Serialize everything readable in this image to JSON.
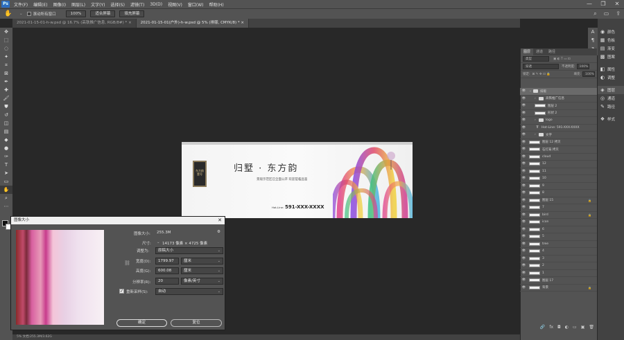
{
  "menu": {
    "logo": "Ps",
    "items": [
      "文件(F)",
      "编辑(E)",
      "图像(I)",
      "图层(L)",
      "文字(Y)",
      "选择(S)",
      "滤镜(T)",
      "3D(D)",
      "视图(V)",
      "窗口(W)",
      "帮助(H)"
    ]
  },
  "window_controls": [
    "—",
    "❐",
    "✕"
  ],
  "options": {
    "scroll_all": "滚动所有窗口",
    "zoom": "100%",
    "fit_screen": "适合屏幕",
    "fill_screen": "填充屏幕"
  },
  "tabs": [
    {
      "label": "2021-01-15-01-h-w.psd @ 16.7% (高铁推广信息, RGB/8#) *",
      "close": "×"
    },
    {
      "label": "2021-01-15-01(户外)-h-w.psd @ 5% (排版, CMYK/8) *",
      "close": "×"
    }
  ],
  "banner": {
    "logo_text": "东方韵 壹号",
    "title": "归墅 · 东方韵",
    "subtitle": "景观示范区已全面公开  欢迎莅临品鉴",
    "hotline_label": "Hot-Line:",
    "phone": "591-XXX-XXXX"
  },
  "right_dock": [
    {
      "icon": "color-icon",
      "glyph": "◉",
      "label": "颜色"
    },
    {
      "icon": "swatches-icon",
      "glyph": "▦",
      "label": "色板"
    },
    {
      "icon": "gradient-icon",
      "glyph": "▤",
      "label": "渐变"
    },
    {
      "icon": "pattern-icon",
      "glyph": "▩",
      "label": "图案"
    },
    {
      "icon": "properties-icon",
      "glyph": "◧",
      "label": "属性"
    },
    {
      "icon": "adjustments-icon",
      "glyph": "◐",
      "label": "调整"
    },
    {
      "icon": "layers-icon",
      "glyph": "◈",
      "label": "图层"
    },
    {
      "icon": "channels-icon",
      "glyph": "◎",
      "label": "通道"
    },
    {
      "icon": "paths-icon",
      "glyph": "✎",
      "label": "路径"
    },
    {
      "icon": "styles-icon",
      "glyph": "❖",
      "label": "样式"
    }
  ],
  "layers_panel": {
    "tabs": [
      "图层",
      "通道",
      "路径"
    ],
    "filter": "类型",
    "blend": "穿透",
    "opacity_label": "不透明度:",
    "opacity": "100%",
    "lock_label": "锁定:",
    "fill_label": "填充:",
    "fill": "100%",
    "layers": [
      {
        "name": "排版",
        "kind": "group",
        "indent": 0,
        "selected": true,
        "lock": false
      },
      {
        "name": "高铁推广信息",
        "kind": "group",
        "indent": 1,
        "selected": false,
        "lock": false
      },
      {
        "name": "图层 2",
        "kind": "pixel",
        "indent": 1,
        "selected": false,
        "lock": false
      },
      {
        "name": "形状 2",
        "kind": "pixel",
        "indent": 1,
        "selected": false,
        "lock": false
      },
      {
        "name": "logo",
        "kind": "group",
        "indent": 1,
        "selected": false,
        "lock": false
      },
      {
        "name": "Hot-Line: 591-XXX-XXXX",
        "kind": "text",
        "indent": 1,
        "selected": false,
        "lock": false
      },
      {
        "name": "文字",
        "kind": "group",
        "indent": 1,
        "selected": false,
        "lock": false
      },
      {
        "name": "图层 12 拷贝",
        "kind": "pixel",
        "indent": 0,
        "selected": false,
        "lock": false
      },
      {
        "name": "石灯笼 拷贝",
        "kind": "pixel",
        "indent": 0,
        "selected": false,
        "lock": false
      },
      {
        "name": "cloud",
        "kind": "pixel",
        "indent": 0,
        "selected": false,
        "lock": false
      },
      {
        "name": "12",
        "kind": "pixel",
        "indent": 0,
        "selected": false,
        "lock": false
      },
      {
        "name": "11",
        "kind": "pixel",
        "indent": 0,
        "selected": false,
        "lock": false
      },
      {
        "name": "10",
        "kind": "pixel",
        "indent": 0,
        "selected": false,
        "lock": false
      },
      {
        "name": "9",
        "kind": "pixel",
        "indent": 0,
        "selected": false,
        "lock": false
      },
      {
        "name": "8",
        "kind": "pixel",
        "indent": 0,
        "selected": false,
        "lock": false
      },
      {
        "name": "图层 15",
        "kind": "pixel",
        "indent": 0,
        "selected": false,
        "lock": true
      },
      {
        "name": "7",
        "kind": "pixel",
        "indent": 0,
        "selected": false,
        "lock": false
      },
      {
        "name": "bird",
        "kind": "pixel",
        "indent": 0,
        "selected": false,
        "lock": true
      },
      {
        "name": "icon",
        "kind": "pixel",
        "indent": 0,
        "selected": false,
        "lock": false
      },
      {
        "name": "6",
        "kind": "pixel",
        "indent": 0,
        "selected": false,
        "lock": false
      },
      {
        "name": "5",
        "kind": "pixel",
        "indent": 0,
        "selected": false,
        "lock": false
      },
      {
        "name": "tree",
        "kind": "pixel",
        "indent": 0,
        "selected": false,
        "lock": false
      },
      {
        "name": "4",
        "kind": "pixel",
        "indent": 0,
        "selected": false,
        "lock": false
      },
      {
        "name": "3",
        "kind": "pixel",
        "indent": 0,
        "selected": false,
        "lock": false
      },
      {
        "name": "2",
        "kind": "pixel",
        "indent": 0,
        "selected": false,
        "lock": false
      },
      {
        "name": "1",
        "kind": "pixel",
        "indent": 0,
        "selected": false,
        "lock": false
      },
      {
        "name": "图层 17",
        "kind": "pixel",
        "indent": 0,
        "selected": false,
        "lock": false
      },
      {
        "name": "背景",
        "kind": "pixel",
        "indent": 0,
        "selected": false,
        "lock": true
      }
    ],
    "bottom_icons": [
      "🔗",
      "fx",
      "◘",
      "◐",
      "▭",
      "▣",
      "🗑"
    ]
  },
  "dialog": {
    "title": "图像大小",
    "close": "✕",
    "image_size_label": "图像大小:",
    "image_size": "255.3M",
    "dimensions_label": "尺寸:",
    "dimensions": "14173 像素 × 4725 像素",
    "fit_label": "调整为:",
    "fit": "原稿大小",
    "width_label": "宽度(D):",
    "width": "1799.97",
    "width_unit": "厘米",
    "height_label": "高度(G):",
    "height": "600.08",
    "height_unit": "厘米",
    "resolution_label": "分辨率(R):",
    "resolution": "20",
    "resolution_unit": "像素/英寸",
    "resample_label": "重新采样(S):",
    "resample": "自动",
    "ok": "确定",
    "reset": "复位"
  },
  "status": "5% 文档:255.3M/3.62G"
}
